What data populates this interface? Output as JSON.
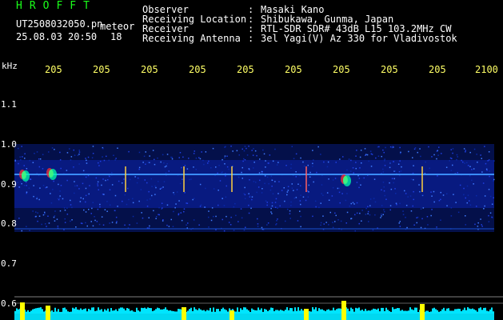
{
  "header": {
    "title": "HROFFT",
    "filename": "UT2508032050.pn",
    "meteor_label": "meteor",
    "datetime": "25.08.03 20:50",
    "count": "18",
    "observer_label": "Observer",
    "observer_value": "Masaki Kano",
    "location_label": "Receiving Location",
    "location_value": "Shibukawa, Gunma, Japan",
    "receiver_label": "Receiver",
    "receiver_value": "RTL-SDR SDR# 43dB L15 103.2MHz CW",
    "antenna_label": "Receiving Antenna",
    "antenna_value": "3el Yagi(V) Az 330 for Vladivostok",
    "separator": ":"
  },
  "axis": {
    "unit": "kHz",
    "y_ticks": [
      "1.1",
      "1.0",
      "0.9",
      "0.8",
      "0.7",
      "0.6"
    ],
    "x_ticks": [
      "205",
      "205",
      "205",
      "205",
      "205",
      "205",
      "205",
      "205",
      "205",
      "2100"
    ]
  },
  "colors": {
    "background": "#000000",
    "title": "#1aff1a",
    "x_tick": "#ffff66",
    "carrier": "#2a78ff",
    "histogram": "#00e5ff",
    "peak": "#ffff00"
  }
}
